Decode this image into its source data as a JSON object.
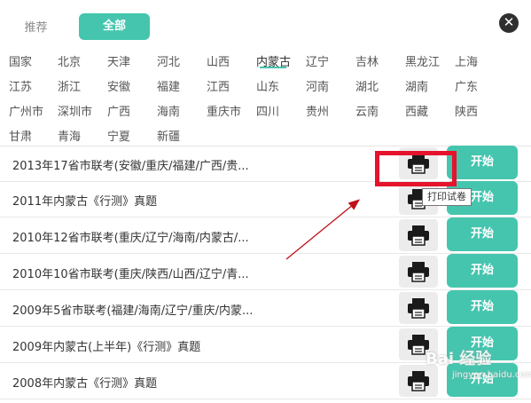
{
  "tabs": {
    "recommend": "推荐",
    "all": "全部"
  },
  "close_icon": "✕",
  "regions": [
    "国家",
    "北京",
    "天津",
    "河北",
    "山西",
    "内蒙古",
    "辽宁",
    "吉林",
    "黑龙江",
    "上海",
    "江苏",
    "浙江",
    "安徽",
    "福建",
    "江西",
    "山东",
    "河南",
    "湖北",
    "湖南",
    "广东",
    "广州市",
    "深圳市",
    "广西",
    "海南",
    "重庆市",
    "四川",
    "贵州",
    "云南",
    "西藏",
    "陕西",
    "甘肃",
    "青海",
    "宁夏",
    "新疆"
  ],
  "active_region": "内蒙古",
  "papers": [
    {
      "title": "2013年17省市联考(安徽/重庆/福建/广西/贵...",
      "start": "开始"
    },
    {
      "title": "2011年内蒙古《行测》真题",
      "start": "开始"
    },
    {
      "title": "2010年12省市联考(重庆/辽宁/海南/内蒙古/...",
      "start": "开始"
    },
    {
      "title": "2010年10省市联考(重庆/陕西/山西/辽宁/青...",
      "start": "开始"
    },
    {
      "title": "2009年5省市联考(福建/海南/辽宁/重庆/内蒙...",
      "start": "开始"
    },
    {
      "title": "2009年内蒙古(上半年)《行测》真题",
      "start": "开始"
    },
    {
      "title": "2008年内蒙古《行测》真题",
      "start": "开始"
    }
  ],
  "tooltip": "打印试卷",
  "watermark": {
    "main": "Bai 经验",
    "sub": "jingyan.baidu.com"
  },
  "colors": {
    "accent": "#45c5ae",
    "highlight": "#e5132c",
    "arrow": "#c0101a"
  },
  "icons": {
    "print": "printer-icon",
    "close": "close-icon"
  }
}
